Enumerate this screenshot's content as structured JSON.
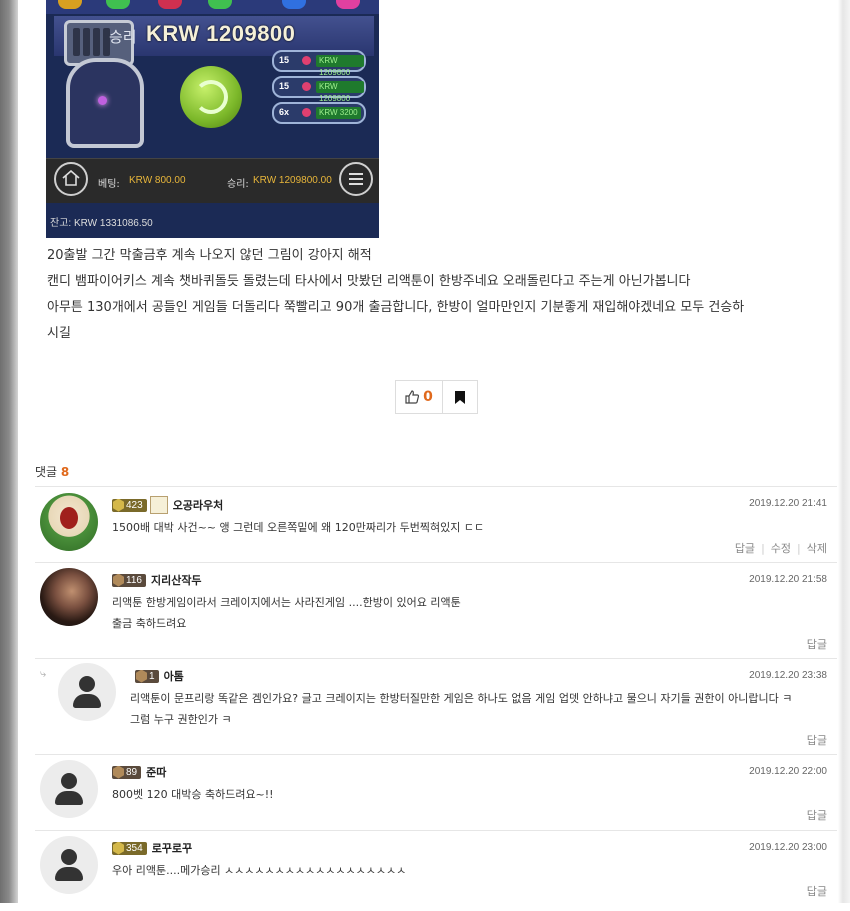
{
  "game": {
    "win_overlay": "승리",
    "win_amount": "KRW 1209800",
    "pills": [
      {
        "count": "15",
        "value": "KRW 1209800"
      },
      {
        "count": "15",
        "value": "KRW 1209800"
      },
      {
        "count": "6x",
        "value": "KRW 3200"
      }
    ],
    "bet_label": "베팅:",
    "bet_value": "KRW 800.00",
    "win_label": "승리:",
    "win_value": "KRW 1209800.00",
    "balance": "잔고: KRW 1331086.50",
    "home_icon": "home-icon",
    "menu_icon": "hamburger-menu-icon"
  },
  "post": {
    "lines": [
      "20출발 그간 막출금후 계속 나오지 않던 그림이 강아지 해적",
      "캔디 뱀파이어키스 계속 챗바퀴돌듯 돌렸는데 타사에서 맛봤던 리액툰이 한방주네요 오래돌린다고 주는게 아닌가봅니다",
      "아무튼 130개에서 공들인 게임들 더돌리다 쭉빨리고 90개 출금합니다, 한방이 얼마만인지 기분좋게 재입해야겠네요 모두 건승하",
      "시길"
    ]
  },
  "actions": {
    "like_count": "0",
    "like_icon": "thumbs-up-icon",
    "bookmark_icon": "bookmark-icon"
  },
  "comments_header": {
    "label": "댓글",
    "count": "8"
  },
  "comments": [
    {
      "level": "423",
      "nick": "오공라우처",
      "date": "2019.12.20 21:41",
      "lines": [
        "1500배 대박 사건~~ 앵 그런데 오른쪽밑에 왜 120만짜리가 두번찍혀있지 ㄷㄷ"
      ],
      "links": [
        "답글",
        "수정",
        "삭제"
      ]
    },
    {
      "level": "116",
      "nick": "지리산작두",
      "date": "2019.12.20 21:58",
      "lines": [
        "리액툰 한방게임이라서 크레이지에서는 사라진게임 ....한방이 있어요 리액툰",
        "출금 축하드려요"
      ],
      "links": [
        "답글"
      ]
    },
    {
      "level": "1",
      "nick": "아톰",
      "date": "2019.12.20 23:38",
      "reply_marker": "⤷",
      "lines": [
        "리액툰이 문프리랑 똑같은 겜인가요? 글고 크레이지는 한방터질만한 게임은 하나도 없음 게임 업뎃 안하냐고 물으니 자기들 권한이 아니랍니다 ㅋ",
        "그럼 누구 권한인가 ㅋ"
      ],
      "links": [
        "답글"
      ]
    },
    {
      "level": "89",
      "nick": "준따",
      "date": "2019.12.20 22:00",
      "lines": [
        "800벳 120 대박승 축하드려요~!!"
      ],
      "links": [
        "답글"
      ]
    },
    {
      "level": "354",
      "nick": "로꾸로꾸",
      "date": "2019.12.20 23:00",
      "lines": [
        "우아 리액툰....메가승리 ㅅㅅㅅㅅㅅㅅㅅㅅㅅㅅㅅㅅㅅㅅㅅㅅㅅㅅ"
      ],
      "links": [
        "답글"
      ]
    }
  ],
  "colors": {
    "accent": "#e0691c",
    "game_bg": "#1b2a55",
    "hud_value": "#e8b63a"
  }
}
